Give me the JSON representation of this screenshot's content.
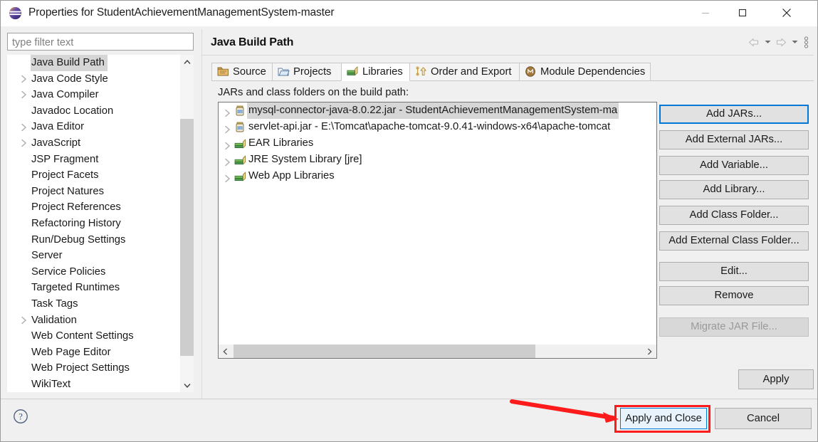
{
  "window": {
    "title": "Properties for StudentAchievementManagementSystem-master",
    "icon": "eclipse-icon",
    "controls": {
      "minimize": "minimize-icon",
      "maximize": "maximize-icon",
      "close": "close-icon"
    }
  },
  "sidebar": {
    "filter": {
      "placeholder": "type filter text",
      "value": ""
    },
    "items": [
      {
        "label": "Java Build Path",
        "expandable": false,
        "selected": true
      },
      {
        "label": "Java Code Style",
        "expandable": true,
        "selected": false
      },
      {
        "label": "Java Compiler",
        "expandable": true,
        "selected": false
      },
      {
        "label": "Javadoc Location",
        "expandable": false,
        "selected": false
      },
      {
        "label": "Java Editor",
        "expandable": true,
        "selected": false
      },
      {
        "label": "JavaScript",
        "expandable": true,
        "selected": false
      },
      {
        "label": "JSP Fragment",
        "expandable": false,
        "selected": false
      },
      {
        "label": "Project Facets",
        "expandable": false,
        "selected": false
      },
      {
        "label": "Project Natures",
        "expandable": false,
        "selected": false
      },
      {
        "label": "Project References",
        "expandable": false,
        "selected": false
      },
      {
        "label": "Refactoring History",
        "expandable": false,
        "selected": false
      },
      {
        "label": "Run/Debug Settings",
        "expandable": false,
        "selected": false
      },
      {
        "label": "Server",
        "expandable": false,
        "selected": false
      },
      {
        "label": "Service Policies",
        "expandable": false,
        "selected": false
      },
      {
        "label": "Targeted Runtimes",
        "expandable": false,
        "selected": false
      },
      {
        "label": "Task Tags",
        "expandable": false,
        "selected": false
      },
      {
        "label": "Validation",
        "expandable": true,
        "selected": false
      },
      {
        "label": "Web Content Settings",
        "expandable": false,
        "selected": false
      },
      {
        "label": "Web Page Editor",
        "expandable": false,
        "selected": false
      },
      {
        "label": "Web Project Settings",
        "expandable": false,
        "selected": false
      },
      {
        "label": "WikiText",
        "expandable": false,
        "selected": false
      }
    ]
  },
  "page": {
    "title": "Java Build Path",
    "nav": [
      "back-arrow-icon",
      "back-dropdown-icon",
      "forward-arrow-icon",
      "forward-dropdown-icon",
      "view-menu-icon"
    ]
  },
  "tabs": [
    {
      "label": "Source",
      "icon": "source-folder-icon",
      "active": false
    },
    {
      "label": "Projects",
      "icon": "project-folder-icon",
      "active": false
    },
    {
      "label": "Libraries",
      "icon": "libraries-books-icon",
      "active": true
    },
    {
      "label": "Order and Export",
      "icon": "order-export-icon",
      "active": false
    },
    {
      "label": "Module Dependencies",
      "icon": "module-icon",
      "active": false
    }
  ],
  "libraries": {
    "hint": "JARs and class folders on the build path:",
    "entries": [
      {
        "label": "mysql-connector-java-8.0.22.jar - StudentAchievementManagementSystem-ma",
        "icon": "jar-icon",
        "expandable": true,
        "selected": true
      },
      {
        "label": "servlet-api.jar - E:\\Tomcat\\apache-tomcat-9.0.41-windows-x64\\apache-tomcat",
        "icon": "jar-icon",
        "expandable": true,
        "selected": false
      },
      {
        "label": "EAR Libraries",
        "icon": "library-icon",
        "expandable": true,
        "selected": false
      },
      {
        "label": "JRE System Library [jre]",
        "icon": "library-icon",
        "expandable": true,
        "selected": false
      },
      {
        "label": "Web App Libraries",
        "icon": "library-icon",
        "expandable": true,
        "selected": false
      }
    ]
  },
  "side_buttons": [
    {
      "label": "Add JARs...",
      "state": "focused"
    },
    {
      "label": "Add External JARs...",
      "state": "normal"
    },
    {
      "label": "Add Variable...",
      "state": "normal"
    },
    {
      "label": "Add Library...",
      "state": "normal"
    },
    {
      "label": "Add Class Folder...",
      "state": "normal"
    },
    {
      "label": "Add External Class Folder...",
      "state": "normal"
    },
    {
      "label": "Edit...",
      "state": "normal"
    },
    {
      "label": "Remove",
      "state": "normal"
    },
    {
      "label": "Migrate JAR File...",
      "state": "disabled"
    }
  ],
  "footer": {
    "apply_label": "Apply",
    "apply_and_close_label": "Apply and Close",
    "cancel_label": "Cancel",
    "help_icon": "help-icon"
  },
  "annotation": {
    "highlight_color": "#fe1b1b",
    "target": "Apply and Close"
  },
  "colors": {
    "accent": "#0078d7",
    "window_bg": "#f0f0f0",
    "list_bg": "#ffffff",
    "selection": "#d6d6d6",
    "annotation_red": "#fe1b1b"
  }
}
